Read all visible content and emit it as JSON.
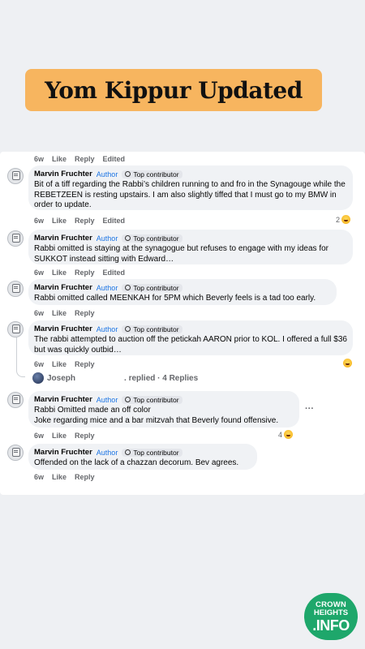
{
  "title": "Yom Kippur Updated",
  "top_meta": {
    "time": "6w",
    "like": "Like",
    "reply": "Reply",
    "edited": "Edited"
  },
  "comments": [
    {
      "name": "Marvin Fruchter",
      "author": "Author",
      "top": "Top contributor",
      "text": "Bit of a tiff regarding the Rabbi’s children running to and fro in the Synagouge while the REBETZEEN is resting upstairs. I am also slightly tiffed that I must go to my BMW in order to update.",
      "time": "6w",
      "like": "Like",
      "reply": "Reply",
      "edited": "Edited",
      "reactions": "2"
    },
    {
      "name": "Marvin Fruchter",
      "author": "Author",
      "top": "Top contributor",
      "text": "Rabbi omitted is staying at the synagogue but refuses to engage with my ideas for SUKKOT instead sitting with Edward…",
      "time": "6w",
      "like": "Like",
      "reply": "Reply",
      "edited": "Edited"
    },
    {
      "name": "Marvin Fruchter",
      "author": "Author",
      "top": "Top contributor",
      "text": "Rabbi omitted called MEENKAH for 5PM which Beverly feels is a tad too early.",
      "time": "6w",
      "like": "Like",
      "reply": "Reply"
    },
    {
      "name": "Marvin Fruchter",
      "author": "Author",
      "top": "Top contributor",
      "text": "The rabbi attempted to auction off the petickah AARON prior to KOL. I offered a full $36 but was quickly outbid…",
      "time": "6w",
      "like": "Like",
      "reply": "Reply"
    },
    {
      "name": "Marvin Fruchter",
      "author": "Author",
      "top": "Top contributor",
      "text": "Rabbi Omitted made an off color\nJoke regarding mice and a bar mitzvah that Beverly found offensive.",
      "time": "6w",
      "like": "Like",
      "reply": "Reply",
      "reactions": "4"
    },
    {
      "name": "Marvin Fruchter",
      "author": "Author",
      "top": "Top contributor",
      "text": "Offended on the lack of a chazzan decorum. Bev agrees.",
      "time": "6w",
      "like": "Like",
      "reply": "Reply"
    }
  ],
  "replies": {
    "name": "Joseph",
    "text": ". replied · 4 Replies"
  },
  "more": "···",
  "logo": {
    "line1": "CROWN",
    "line2": "HEIGHTS",
    "line3": ".INFO"
  }
}
